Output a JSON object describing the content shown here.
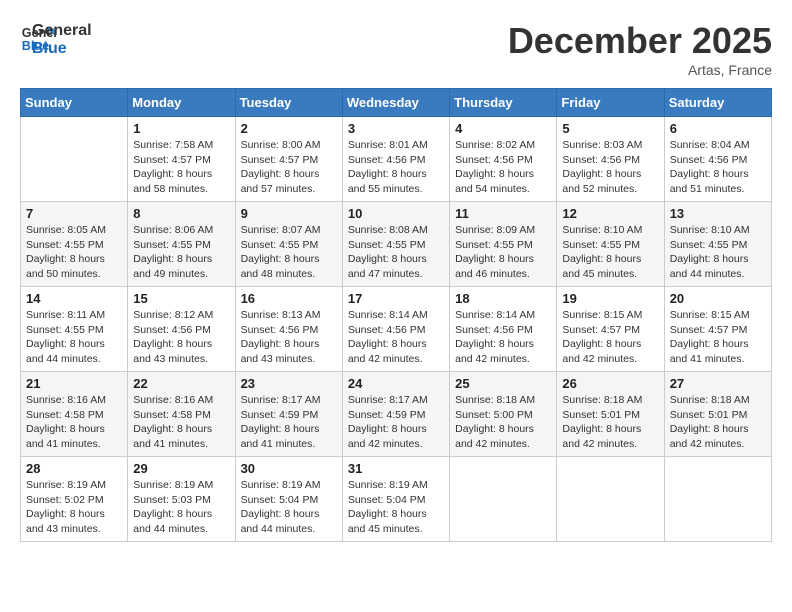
{
  "logo": {
    "line1": "General",
    "line2": "Blue"
  },
  "title": "December 2025",
  "location": "Artas, France",
  "days_header": [
    "Sunday",
    "Monday",
    "Tuesday",
    "Wednesday",
    "Thursday",
    "Friday",
    "Saturday"
  ],
  "weeks": [
    [
      {
        "num": "",
        "info": ""
      },
      {
        "num": "1",
        "info": "Sunrise: 7:58 AM\nSunset: 4:57 PM\nDaylight: 8 hours\nand 58 minutes."
      },
      {
        "num": "2",
        "info": "Sunrise: 8:00 AM\nSunset: 4:57 PM\nDaylight: 8 hours\nand 57 minutes."
      },
      {
        "num": "3",
        "info": "Sunrise: 8:01 AM\nSunset: 4:56 PM\nDaylight: 8 hours\nand 55 minutes."
      },
      {
        "num": "4",
        "info": "Sunrise: 8:02 AM\nSunset: 4:56 PM\nDaylight: 8 hours\nand 54 minutes."
      },
      {
        "num": "5",
        "info": "Sunrise: 8:03 AM\nSunset: 4:56 PM\nDaylight: 8 hours\nand 52 minutes."
      },
      {
        "num": "6",
        "info": "Sunrise: 8:04 AM\nSunset: 4:56 PM\nDaylight: 8 hours\nand 51 minutes."
      }
    ],
    [
      {
        "num": "7",
        "info": "Sunrise: 8:05 AM\nSunset: 4:55 PM\nDaylight: 8 hours\nand 50 minutes."
      },
      {
        "num": "8",
        "info": "Sunrise: 8:06 AM\nSunset: 4:55 PM\nDaylight: 8 hours\nand 49 minutes."
      },
      {
        "num": "9",
        "info": "Sunrise: 8:07 AM\nSunset: 4:55 PM\nDaylight: 8 hours\nand 48 minutes."
      },
      {
        "num": "10",
        "info": "Sunrise: 8:08 AM\nSunset: 4:55 PM\nDaylight: 8 hours\nand 47 minutes."
      },
      {
        "num": "11",
        "info": "Sunrise: 8:09 AM\nSunset: 4:55 PM\nDaylight: 8 hours\nand 46 minutes."
      },
      {
        "num": "12",
        "info": "Sunrise: 8:10 AM\nSunset: 4:55 PM\nDaylight: 8 hours\nand 45 minutes."
      },
      {
        "num": "13",
        "info": "Sunrise: 8:10 AM\nSunset: 4:55 PM\nDaylight: 8 hours\nand 44 minutes."
      }
    ],
    [
      {
        "num": "14",
        "info": "Sunrise: 8:11 AM\nSunset: 4:55 PM\nDaylight: 8 hours\nand 44 minutes."
      },
      {
        "num": "15",
        "info": "Sunrise: 8:12 AM\nSunset: 4:56 PM\nDaylight: 8 hours\nand 43 minutes."
      },
      {
        "num": "16",
        "info": "Sunrise: 8:13 AM\nSunset: 4:56 PM\nDaylight: 8 hours\nand 43 minutes."
      },
      {
        "num": "17",
        "info": "Sunrise: 8:14 AM\nSunset: 4:56 PM\nDaylight: 8 hours\nand 42 minutes."
      },
      {
        "num": "18",
        "info": "Sunrise: 8:14 AM\nSunset: 4:56 PM\nDaylight: 8 hours\nand 42 minutes."
      },
      {
        "num": "19",
        "info": "Sunrise: 8:15 AM\nSunset: 4:57 PM\nDaylight: 8 hours\nand 42 minutes."
      },
      {
        "num": "20",
        "info": "Sunrise: 8:15 AM\nSunset: 4:57 PM\nDaylight: 8 hours\nand 41 minutes."
      }
    ],
    [
      {
        "num": "21",
        "info": "Sunrise: 8:16 AM\nSunset: 4:58 PM\nDaylight: 8 hours\nand 41 minutes."
      },
      {
        "num": "22",
        "info": "Sunrise: 8:16 AM\nSunset: 4:58 PM\nDaylight: 8 hours\nand 41 minutes."
      },
      {
        "num": "23",
        "info": "Sunrise: 8:17 AM\nSunset: 4:59 PM\nDaylight: 8 hours\nand 41 minutes."
      },
      {
        "num": "24",
        "info": "Sunrise: 8:17 AM\nSunset: 4:59 PM\nDaylight: 8 hours\nand 42 minutes."
      },
      {
        "num": "25",
        "info": "Sunrise: 8:18 AM\nSunset: 5:00 PM\nDaylight: 8 hours\nand 42 minutes."
      },
      {
        "num": "26",
        "info": "Sunrise: 8:18 AM\nSunset: 5:01 PM\nDaylight: 8 hours\nand 42 minutes."
      },
      {
        "num": "27",
        "info": "Sunrise: 8:18 AM\nSunset: 5:01 PM\nDaylight: 8 hours\nand 42 minutes."
      }
    ],
    [
      {
        "num": "28",
        "info": "Sunrise: 8:19 AM\nSunset: 5:02 PM\nDaylight: 8 hours\nand 43 minutes."
      },
      {
        "num": "29",
        "info": "Sunrise: 8:19 AM\nSunset: 5:03 PM\nDaylight: 8 hours\nand 44 minutes."
      },
      {
        "num": "30",
        "info": "Sunrise: 8:19 AM\nSunset: 5:04 PM\nDaylight: 8 hours\nand 44 minutes."
      },
      {
        "num": "31",
        "info": "Sunrise: 8:19 AM\nSunset: 5:04 PM\nDaylight: 8 hours\nand 45 minutes."
      },
      {
        "num": "",
        "info": ""
      },
      {
        "num": "",
        "info": ""
      },
      {
        "num": "",
        "info": ""
      }
    ]
  ]
}
